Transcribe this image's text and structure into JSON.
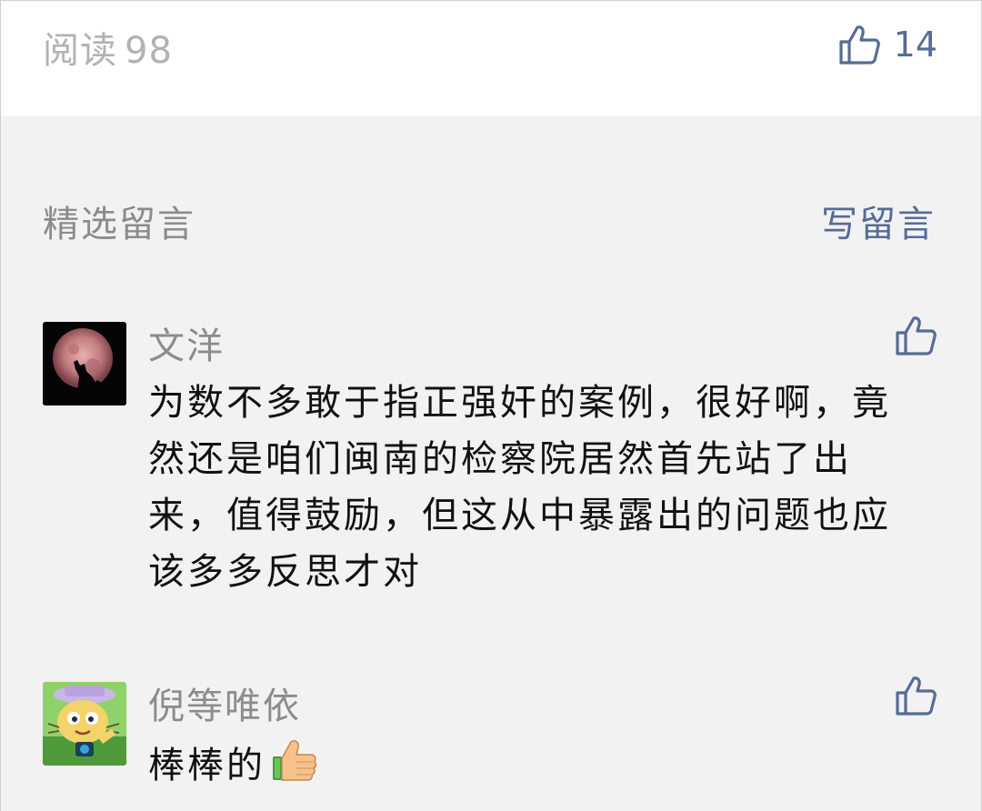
{
  "header": {
    "read_label": "阅读",
    "read_count": "98",
    "like_count": "14"
  },
  "comments_section": {
    "title": "精选留言",
    "write_label": "写留言",
    "comments": [
      {
        "nickname": "文洋",
        "avatar_icon": "wolf-moon-avatar",
        "text": "为数不多敢于指正强奸的案例，很好啊，竟然还是咱们闽南的检察院居然首先站了出来，值得鼓励，但这从中暴露出的问题也应该多多反思才对"
      },
      {
        "nickname": "倪等唯依",
        "avatar_icon": "cartoon-cat-avatar",
        "text": "棒棒的",
        "emoji": "thumbs-up-emoji"
      }
    ]
  },
  "colors": {
    "link": "#576b95",
    "muted": "#8c8c8c",
    "text": "#111111",
    "background": "#f2f2f2"
  }
}
